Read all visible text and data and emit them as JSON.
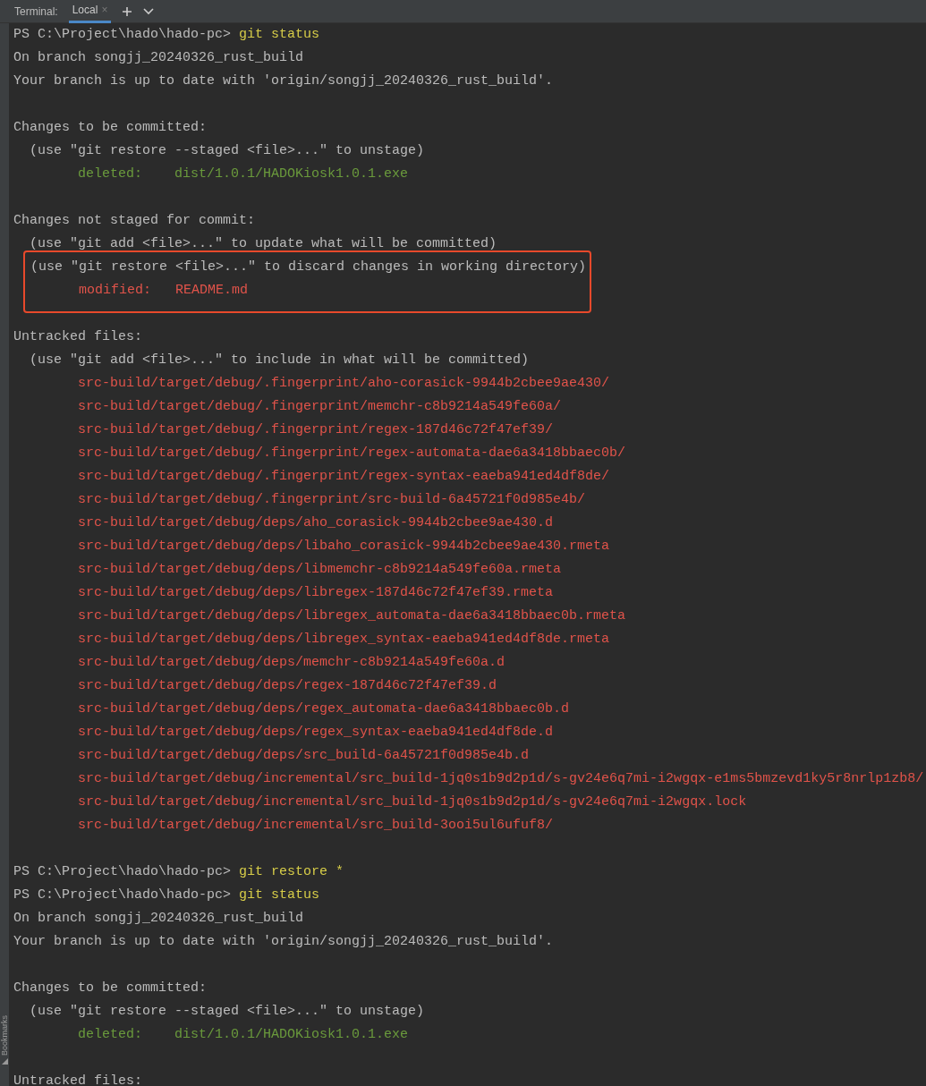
{
  "tool_window": {
    "title": "Terminal:",
    "tabs": [
      {
        "label": "Local",
        "selected": true,
        "close": "×"
      }
    ],
    "side_label": "Bookmarks"
  },
  "lines": [
    {
      "kind": "prompt",
      "prompt": "PS C:\\Project\\hado\\hado-pc>",
      "command": "git status"
    },
    {
      "kind": "text",
      "text": "On branch songjj_20240326_rust_build"
    },
    {
      "kind": "text",
      "text": "Your branch is up to date with 'origin/songjj_20240326_rust_build'."
    },
    {
      "kind": "blank"
    },
    {
      "kind": "text",
      "text": "Changes to be committed:"
    },
    {
      "kind": "hint",
      "text": "(use \"git restore --staged <file>...\" to unstage)"
    },
    {
      "kind": "staged",
      "label": "deleted:",
      "path": "dist/1.0.1/HADOKiosk1.0.1.exe"
    },
    {
      "kind": "blank"
    },
    {
      "kind": "text",
      "text": "Changes not staged for commit:"
    },
    {
      "kind": "hint",
      "text": "(use \"git add <file>...\" to update what will be committed)"
    },
    {
      "kind": "box",
      "children": [
        {
          "kind": "hint",
          "text": "(use \"git restore <file>...\" to discard changes in working directory)"
        },
        {
          "kind": "unstaged",
          "label": "modified:",
          "path": "README.md"
        }
      ]
    },
    {
      "kind": "blank"
    },
    {
      "kind": "text",
      "text": "Untracked files:"
    },
    {
      "kind": "hint",
      "text": "(use \"git add <file>...\" to include in what will be committed)"
    },
    {
      "kind": "untracked",
      "path": "src-build/target/debug/.fingerprint/aho-corasick-9944b2cbee9ae430/"
    },
    {
      "kind": "untracked",
      "path": "src-build/target/debug/.fingerprint/memchr-c8b9214a549fe60a/"
    },
    {
      "kind": "untracked",
      "path": "src-build/target/debug/.fingerprint/regex-187d46c72f47ef39/"
    },
    {
      "kind": "untracked",
      "path": "src-build/target/debug/.fingerprint/regex-automata-dae6a3418bbaec0b/"
    },
    {
      "kind": "untracked",
      "path": "src-build/target/debug/.fingerprint/regex-syntax-eaeba941ed4df8de/"
    },
    {
      "kind": "untracked",
      "path": "src-build/target/debug/.fingerprint/src-build-6a45721f0d985e4b/"
    },
    {
      "kind": "untracked",
      "path": "src-build/target/debug/deps/aho_corasick-9944b2cbee9ae430.d"
    },
    {
      "kind": "untracked",
      "path": "src-build/target/debug/deps/libaho_corasick-9944b2cbee9ae430.rmeta"
    },
    {
      "kind": "untracked",
      "path": "src-build/target/debug/deps/libmemchr-c8b9214a549fe60a.rmeta"
    },
    {
      "kind": "untracked",
      "path": "src-build/target/debug/deps/libregex-187d46c72f47ef39.rmeta"
    },
    {
      "kind": "untracked",
      "path": "src-build/target/debug/deps/libregex_automata-dae6a3418bbaec0b.rmeta"
    },
    {
      "kind": "untracked",
      "path": "src-build/target/debug/deps/libregex_syntax-eaeba941ed4df8de.rmeta"
    },
    {
      "kind": "untracked",
      "path": "src-build/target/debug/deps/memchr-c8b9214a549fe60a.d"
    },
    {
      "kind": "untracked",
      "path": "src-build/target/debug/deps/regex-187d46c72f47ef39.d"
    },
    {
      "kind": "untracked",
      "path": "src-build/target/debug/deps/regex_automata-dae6a3418bbaec0b.d"
    },
    {
      "kind": "untracked",
      "path": "src-build/target/debug/deps/regex_syntax-eaeba941ed4df8de.d"
    },
    {
      "kind": "untracked",
      "path": "src-build/target/debug/deps/src_build-6a45721f0d985e4b.d"
    },
    {
      "kind": "untracked",
      "path": "src-build/target/debug/incremental/src_build-1jq0s1b9d2p1d/s-gv24e6q7mi-i2wgqx-e1ms5bmzevd1ky5r8nrlp1zb8/"
    },
    {
      "kind": "untracked",
      "path": "src-build/target/debug/incremental/src_build-1jq0s1b9d2p1d/s-gv24e6q7mi-i2wgqx.lock"
    },
    {
      "kind": "untracked",
      "path": "src-build/target/debug/incremental/src_build-3ooi5ul6ufuf8/"
    },
    {
      "kind": "blank"
    },
    {
      "kind": "prompt",
      "prompt": "PS C:\\Project\\hado\\hado-pc>",
      "command": "git restore *"
    },
    {
      "kind": "prompt",
      "prompt": "PS C:\\Project\\hado\\hado-pc>",
      "command": "git status"
    },
    {
      "kind": "text",
      "text": "On branch songjj_20240326_rust_build"
    },
    {
      "kind": "text",
      "text": "Your branch is up to date with 'origin/songjj_20240326_rust_build'."
    },
    {
      "kind": "blank"
    },
    {
      "kind": "text",
      "text": "Changes to be committed:"
    },
    {
      "kind": "hint",
      "text": "(use \"git restore --staged <file>...\" to unstage)"
    },
    {
      "kind": "staged",
      "label": "deleted:",
      "path": "dist/1.0.1/HADOKiosk1.0.1.exe"
    },
    {
      "kind": "blank"
    },
    {
      "kind": "text",
      "text": "Untracked files:"
    }
  ]
}
